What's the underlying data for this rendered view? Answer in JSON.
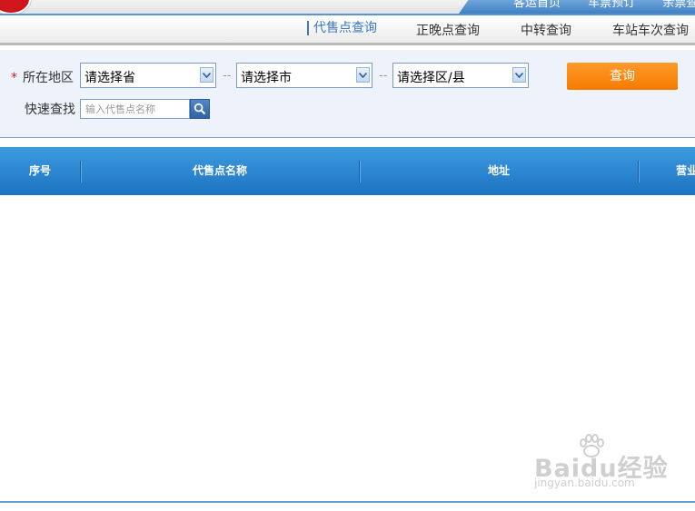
{
  "topnav": {
    "links": [
      "客运首页",
      "车票预订",
      "余票查"
    ]
  },
  "subnav": {
    "items": [
      "代售点查询",
      "正晚点查询",
      "中转查询",
      "车站车次查询"
    ],
    "active_index": 0
  },
  "filter": {
    "region_label": "所在地区",
    "required_mark": "*",
    "province_placeholder": "请选择省",
    "city_placeholder": "请选择市",
    "district_placeholder": "请选择区/县",
    "separator": "--",
    "query_button": "查询",
    "quick_find_label": "快速查找",
    "quick_find_placeholder": "输入代售点名称"
  },
  "table": {
    "headers": [
      "序号",
      "代售点名称",
      "地址",
      "营业"
    ],
    "rows": []
  },
  "watermark": {
    "brand": "Baidu经验",
    "url": "jingyan.baidu.com"
  },
  "colors": {
    "accent_blue": "#3a78c2",
    "header_blue": "#1d73c2",
    "query_orange": "#f57b00",
    "required_red": "#e0161b"
  }
}
